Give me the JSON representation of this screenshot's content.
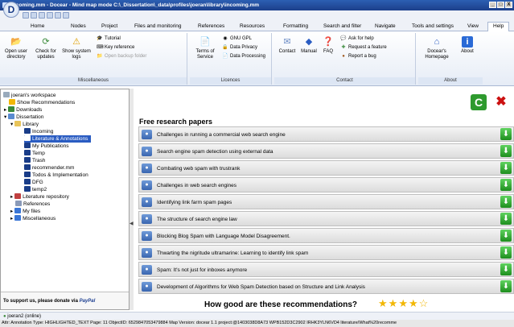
{
  "window": {
    "title": "incoming.mm - Docear - Mind map mode C:\\_Dissertation\\_data\\profiles\\joeran\\library\\incoming.mm",
    "buttons": [
      "_",
      "□",
      "X"
    ]
  },
  "menu": {
    "orb_label": "D"
  },
  "tabs": [
    "Home",
    "Nodes",
    "Project",
    "Files and monitoring",
    "References",
    "Resources",
    "Formatting",
    "Search and filter",
    "Navigate",
    "Tools and settings",
    "View",
    "Help"
  ],
  "ribbon": {
    "misc": {
      "label": "Miscellaneous",
      "open_user_dir": "Open user directory",
      "check_updates": "Check for updates",
      "show_logs": "Show system logs",
      "tutorial": "Tutorial",
      "key_reference": "Key reference",
      "open_backup": "Open backup folder"
    },
    "licences": {
      "label": "Licences",
      "terms": "Terms of Service",
      "gnu_gpl": "GNU GPL",
      "data_privacy": "Data Privacy",
      "data_processing": "Data Processing"
    },
    "contact": {
      "label": "Contact",
      "contact": "Contact",
      "manual": "Manual",
      "faq": "FAQ",
      "ask_help": "Ask for help",
      "request_feature": "Request a feature",
      "report_bug": "Report a bug"
    },
    "about": {
      "label": "About",
      "homepage": "Docear's Homepage",
      "about": "About"
    }
  },
  "tree": [
    {
      "label": "joeran's workspace"
    },
    {
      "label": "Show Recommendations"
    },
    {
      "label": "Downloads"
    },
    {
      "label": "Dissertation"
    },
    {
      "label": "Library"
    },
    {
      "label": "Incoming"
    },
    {
      "label": "Literature & Annotations"
    },
    {
      "label": "My Publications"
    },
    {
      "label": "Temp"
    },
    {
      "label": "Trash"
    },
    {
      "label": "recommender.mm"
    },
    {
      "label": "Todos & Implementation"
    },
    {
      "label": "DFG"
    },
    {
      "label": "temp2"
    },
    {
      "label": "Literature repository"
    },
    {
      "label": "References"
    },
    {
      "label": "My files"
    },
    {
      "label": "Miscellaneous"
    }
  ],
  "donate": {
    "text": "To support us, please donate via",
    "paypal": "PayPal"
  },
  "main": {
    "title": "Free research papers",
    "papers": [
      "Challenges in running a commercial web search engine",
      "Search engine spam detection using external data",
      "Combating web spam with trustrank",
      "Challenges in web search engines",
      "Identifying link farm spam pages",
      "The structure of search engine law",
      "Blocking Blog Spam with Language Model Disagreement.",
      "Thwarting the nigritude ultramarine: Learning to identify link spam",
      "Spam: It's not just for inboxes anymore",
      "Development of Algorithms for Web Spam Detection based on Structure and Link Analysis"
    ],
    "rating_question": "How good are these recommendations?",
    "rating": {
      "filled": 4,
      "total": 5
    }
  },
  "status": {
    "user": "joeran2 (online)",
    "attr": "Attr: Annotation Type: HIGHLIGHTED_TEXT Page: 11 ObjectID: 6529847053479884 Map Version: docear 1.1 project:@1403038D8A73 WPB152D3C2902 IRHK3YLN6VD4 literature/What%20recomme"
  },
  "colors": {
    "accent": "#2a5cc2",
    "refresh": "#2e9a2e",
    "close": "#cc1111",
    "star": "#f2b705",
    "download": "#1e8e1e"
  }
}
